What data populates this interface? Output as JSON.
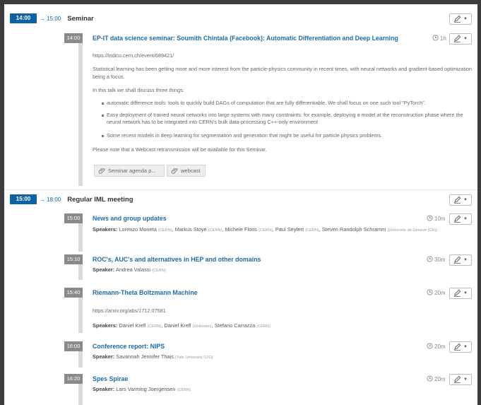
{
  "sessions": [
    {
      "start": "14:00",
      "end": "→ 15:00",
      "title": "Seminar"
    },
    {
      "start": "15:00",
      "end": "→ 18:00",
      "title": "Regular IML meeting"
    }
  ],
  "contributions": {
    "c1": {
      "time": "14:00",
      "title": "EP-IT data science seminar: Soumith Chintala (Facebook): Automatic Differentiation and Deep Learning",
      "duration": "1h",
      "url": "https://indico.cern.ch/event/689421/",
      "para1": "Statistical learning has been getting more and more interest from the particle-physics community in recent times, with neural networks and gradient-based optimization being a focus.",
      "para2": "In this talk we shall discuss three things:",
      "bullets": [
        "automatic difference tools: tools to quickly build DAGs of computation that are fully differentiable. We shall focus on one such tool \"PyTorch\".",
        "Easy deployment of trained neural networks into large systems with many constraints: for example, deploying a model at the reconstruction phase where the neural network has to be integrated into CERN's bulk data-processing C++-only environment",
        "Some recent models in deep learning for segmentation and generation that might be useful for particle physics problems."
      ],
      "para3": "Please note that a Webcast retransmission will be available for this Seminar.",
      "attachments": [
        "Seminar agenda p...",
        "webcast"
      ]
    },
    "c2": {
      "time": "15:00",
      "title": "News and group updates",
      "duration": "10m",
      "speakers_label": "Speakers",
      "speakers": [
        {
          "name": "Lorenzo Moneta",
          "aff": "(CERN)"
        },
        {
          "name": "Markus Stoye",
          "aff": "(CERN)"
        },
        {
          "name": "Michele Floris",
          "aff": "(CERN)"
        },
        {
          "name": "Paul Seyfert",
          "aff": "(CERN)"
        },
        {
          "name": "Steven Randolph Schramm",
          "aff": "(Universite de Geneve (CH))"
        }
      ]
    },
    "c3": {
      "time": "15:10",
      "title": "ROC's, AUC's and alternatives in HEP and other domains",
      "duration": "30m",
      "speakers_label": "Speaker",
      "speakers": [
        {
          "name": "Andrea Valassi",
          "aff": "(CERN)"
        }
      ]
    },
    "c4": {
      "time": "15:40",
      "title": "Riemann-Theta Boltzmann Machine",
      "duration": "20m",
      "url": "https://arxiv.org/abs/1712.07581",
      "speakers_label": "Speakers",
      "speakers": [
        {
          "name": "Daniel Krefl",
          "aff": "(CERN)"
        },
        {
          "name": "Daniel Krefl",
          "aff": "(Unknown)"
        },
        {
          "name": "Stefano Carrazza",
          "aff": "(CERN)"
        }
      ]
    },
    "c5": {
      "time": "16:00",
      "title": "Conference report: NIPS",
      "duration": "20m",
      "speakers_label": "Speaker",
      "speakers": [
        {
          "name": "Savannah Jennifer Thais",
          "aff": "(Yale University (US))"
        }
      ]
    },
    "c6": {
      "time": "16:20",
      "title": "Spes Spirae",
      "duration": "20m",
      "speakers_label": "Speaker",
      "speakers": [
        {
          "name": "Lars Varming Joergensen",
          "aff": "(CERN)"
        }
      ]
    }
  },
  "icons": {
    "edit": "pencil-icon",
    "menu": "caret-down-icon",
    "duration": "clock-icon",
    "attachment": "paperclip-icon"
  },
  "colors": {
    "accent": "#0c64a7",
    "title_link": "#1d6aa8",
    "time_badge": "#8a8a8a"
  }
}
